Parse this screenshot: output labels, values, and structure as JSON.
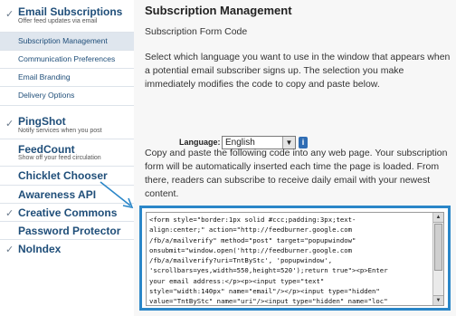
{
  "sidebar": {
    "email_subscriptions": {
      "check": "✓",
      "title": "Email Subscriptions",
      "subtitle": "Offer feed updates via email",
      "items": [
        {
          "label": "Subscription Management"
        },
        {
          "label": "Communication Preferences"
        },
        {
          "label": "Email Branding"
        },
        {
          "label": "Delivery Options"
        }
      ]
    },
    "pingshot": {
      "check": "✓",
      "title": "PingShot",
      "subtitle": "Notify services when you post"
    },
    "feedcount": {
      "title": "FeedCount",
      "subtitle": "Show off your feed circulation"
    },
    "chicklet_chooser": {
      "title": "Chicklet Chooser"
    },
    "awareness_api": {
      "title": "Awareness API"
    },
    "creative_commons": {
      "check": "✓",
      "title": "Creative Commons"
    },
    "password_protector": {
      "title": "Password Protector"
    },
    "noindex": {
      "check": "✓",
      "title": "NoIndex"
    }
  },
  "main": {
    "title": "Subscription Management",
    "section_title": "Subscription Form Code",
    "intro": "Select which language you want to use in the window that appears when a potential email subscriber signs up. The selection you make immediately modifies the code to copy and paste below.",
    "language": {
      "label": "Language:",
      "selected": "English",
      "dropdown_icon": "▼",
      "info_icon": "i"
    },
    "instructions": "Copy and paste the following code into any web page. Your subscription form will be automatically inserted each time the page is loaded. From there, readers can subscribe to receive daily email with your newest content.",
    "code": "<form style=\"border:1px solid #ccc;padding:3px;text-\nalign:center;\" action=\"http://feedburner.google.com\n/fb/a/mailverify\" method=\"post\" target=\"popupwindow\"\nonsubmit=\"window.open('http://feedburner.google.com\n/fb/a/mailverify?uri=TntByStc', 'popupwindow',\n'scrollbars=yes,width=550,height=520');return true\"><p>Enter\nyour email address:</p><p><input type=\"text\"\nstyle=\"width:140px\" name=\"email\"/></p><input type=\"hidden\"\nvalue=\"TntByStc\" name=\"uri\"/><input type=\"hidden\" name=\"loc\"",
    "scroll_up": "▲",
    "scroll_down": "▼"
  },
  "colors": {
    "accent": "#2a86c8",
    "link": "#1f4e79",
    "active_bg": "#dfe6ee"
  }
}
